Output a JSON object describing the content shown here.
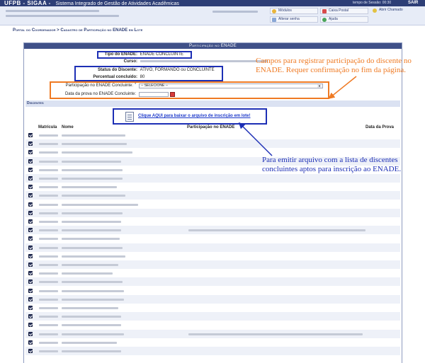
{
  "header": {
    "brand": "UFPB - SIGAA -",
    "subtitle": "Sistema Integrado de Gestão de Atividades Acadêmicas",
    "session_timer": "tempo de Sessão: 00:30",
    "exit_label": "SAIR"
  },
  "quick_links": {
    "modulos": "Módulos",
    "caixa_postal": "Caixa Postal",
    "abrir_chamado": "Abrir Chamado",
    "alterar_senha": "Alterar senha",
    "ajuda": "Ajuda"
  },
  "breadcrumb": "Portal do Coordenador > Cadastro de Participação no ENADE em Lote",
  "panel_title": "Participação no ENADE",
  "info": {
    "tipo_label": "Tipo do ENADE:",
    "tipo_value": "ENADE CONCLUINTE",
    "curso_label": "Curso:",
    "status_label": "Status do Discente:",
    "status_value": "ATIVO, FORMANDO ou CONCLUINTE",
    "percentual_label": "Percentual concluído:",
    "percentual_value": "80"
  },
  "form": {
    "participacao_label": "Participação no ENADE Concluinte:",
    "participacao_selected": "-- SELECIONE --",
    "data_label": "Data da prova no ENADE Concluinte:",
    "required_mark": "*"
  },
  "discentes_header": "Discentes",
  "download_link": "Clique AQUI para baixar o arquivo de inscrição em lote!",
  "table": {
    "columns": [
      "Matrícula",
      "Nome",
      "Participação no ENADE",
      "Data da Prova"
    ]
  },
  "annotations": {
    "orange": "Campos para registrar participação do discente no ENADE. Requer confirmação no fim da página.",
    "blue": "Para emitir arquivo com a lista de discentes concluintes aptos para inscrição ao ENADE."
  },
  "colors": {
    "header_bg": "#2d3e76",
    "frame_blue": "#1d2fb5",
    "frame_orange": "#ef7a23"
  }
}
